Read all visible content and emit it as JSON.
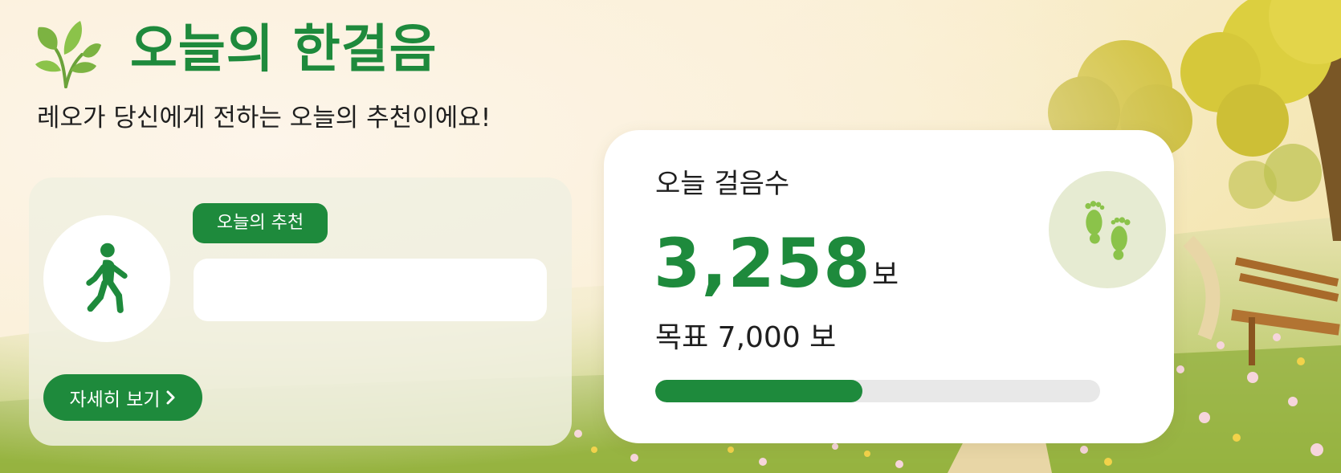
{
  "header": {
    "title": "오늘의 한걸음",
    "subtitle": "레오가 당신에게 전하는 오늘의 추천이에요!",
    "logo_icon": "leaf-sprout-icon"
  },
  "recommendation": {
    "badge_label": "오늘의 추천",
    "text": "",
    "icon": "walking-person-icon",
    "detail_button_label": "자세히 보기"
  },
  "steps": {
    "label": "오늘 걸음수",
    "value": "3,258",
    "unit": "보",
    "goal_text": "목표 7,000 보",
    "current": 3258,
    "goal": 7000,
    "icon": "footprints-icon"
  },
  "colors": {
    "accent": "#1e8a3c",
    "card_bg": "#ffffff",
    "track": "#e8e8e8",
    "background": "#fbf3df"
  }
}
